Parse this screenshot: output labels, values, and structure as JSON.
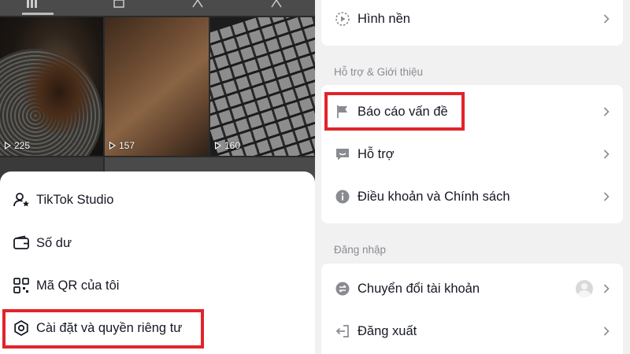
{
  "profile_panel": {
    "videos": [
      {
        "views": "225"
      },
      {
        "views": "157"
      },
      {
        "views": "160"
      }
    ],
    "menu": [
      {
        "label": "TikTok Studio",
        "icon": "person-star-icon"
      },
      {
        "label": "Số dư",
        "icon": "wallet-icon"
      },
      {
        "label": "Mã QR của tôi",
        "icon": "qr-code-icon"
      },
      {
        "label": "Cài đặt và quyền riêng tư",
        "icon": "gear-icon",
        "highlighted": true
      }
    ]
  },
  "settings_panel": {
    "display_items": [
      {
        "label": "Hình nền",
        "icon": "wallpaper-icon"
      }
    ],
    "support_section": {
      "title": "Hỗ trợ & Giới thiệu",
      "items": [
        {
          "label": "Báo cáo vấn đề",
          "icon": "flag-icon",
          "highlighted": true
        },
        {
          "label": "Hỗ trợ",
          "icon": "chat-bubble-icon"
        },
        {
          "label": "Điều khoản và Chính sách",
          "icon": "info-icon"
        }
      ]
    },
    "login_section": {
      "title": "Đăng nhập",
      "items": [
        {
          "label": "Chuyển đổi tài khoản",
          "icon": "switch-icon"
        },
        {
          "label": "Đăng xuất",
          "icon": "logout-icon"
        }
      ]
    }
  },
  "colors": {
    "highlight": "#e1242b",
    "text": "#161823",
    "secondary": "#8a8b91",
    "background": "#f1f1f2"
  }
}
